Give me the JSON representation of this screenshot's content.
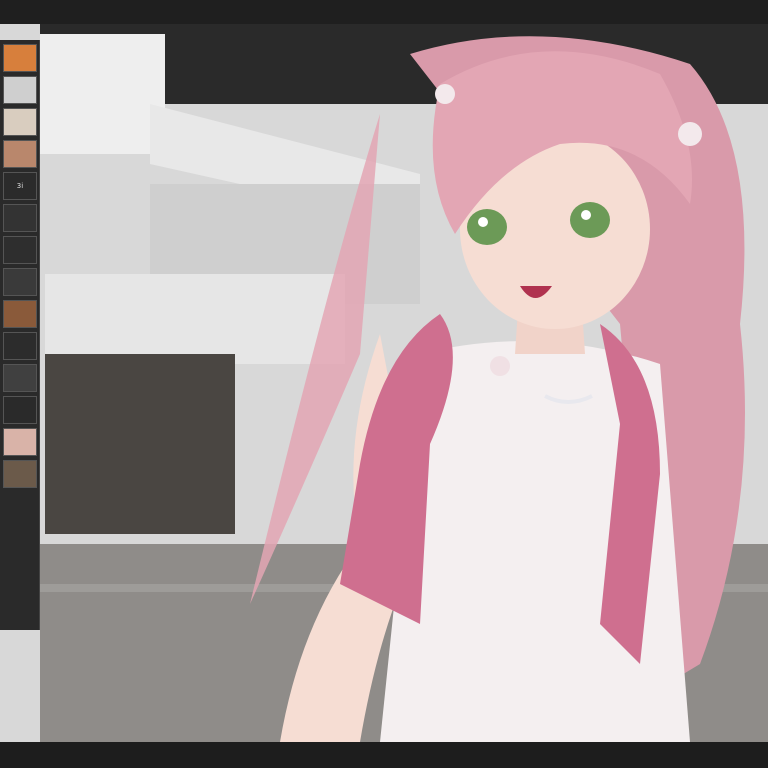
{
  "image": {
    "subject": "anime-character",
    "colors": {
      "hair": "#e3a6b4",
      "jacket": "#cf6f8f",
      "top": "#f4eff0",
      "eyes": "#6c9a57",
      "skin": "#f6ddd3",
      "wall_light": "#e9e9e9",
      "wall_dark": "#4a4642",
      "floor": "#8f8c89",
      "frame": "#1d1d1d"
    }
  },
  "sidebar": {
    "thumbnails": [
      {
        "label": "",
        "color": "#d77f3c"
      },
      {
        "label": "",
        "color": "#cfcfcf"
      },
      {
        "label": "",
        "color": "#d9cdbf"
      },
      {
        "label": "",
        "color": "#b9876c"
      },
      {
        "label": "3i",
        "color": "#2b2b2b"
      },
      {
        "label": "",
        "color": "#333333"
      },
      {
        "label": "",
        "color": "#2e2e2e"
      },
      {
        "label": "",
        "color": "#3a3a3a"
      },
      {
        "label": "",
        "color": "#8a5a3a"
      },
      {
        "label": "",
        "color": "#2c2c2c"
      },
      {
        "label": "",
        "color": "#404040"
      },
      {
        "label": "",
        "color": "#2a2a2a"
      },
      {
        "label": "",
        "color": "#d9b3a8"
      },
      {
        "label": "",
        "color": "#6b5a4a"
      }
    ]
  }
}
